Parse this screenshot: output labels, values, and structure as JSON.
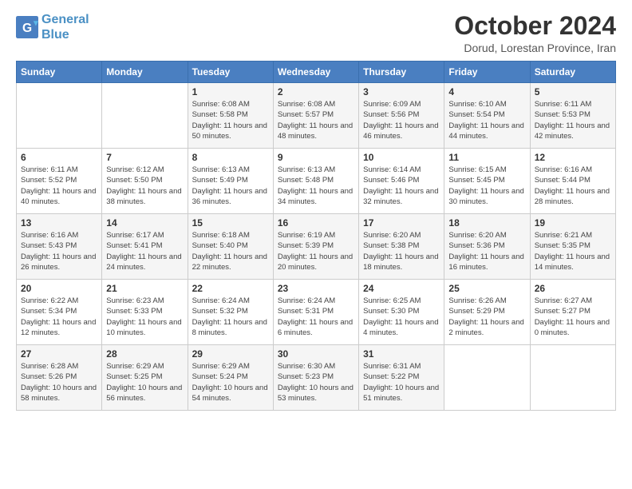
{
  "logo": {
    "line1": "General",
    "line2": "Blue"
  },
  "title": "October 2024",
  "subtitle": "Dorud, Lorestan Province, Iran",
  "days_of_week": [
    "Sunday",
    "Monday",
    "Tuesday",
    "Wednesday",
    "Thursday",
    "Friday",
    "Saturday"
  ],
  "weeks": [
    [
      {
        "day": "",
        "info": ""
      },
      {
        "day": "",
        "info": ""
      },
      {
        "day": "1",
        "info": "Sunrise: 6:08 AM\nSunset: 5:58 PM\nDaylight: 11 hours and 50 minutes."
      },
      {
        "day": "2",
        "info": "Sunrise: 6:08 AM\nSunset: 5:57 PM\nDaylight: 11 hours and 48 minutes."
      },
      {
        "day": "3",
        "info": "Sunrise: 6:09 AM\nSunset: 5:56 PM\nDaylight: 11 hours and 46 minutes."
      },
      {
        "day": "4",
        "info": "Sunrise: 6:10 AM\nSunset: 5:54 PM\nDaylight: 11 hours and 44 minutes."
      },
      {
        "day": "5",
        "info": "Sunrise: 6:11 AM\nSunset: 5:53 PM\nDaylight: 11 hours and 42 minutes."
      }
    ],
    [
      {
        "day": "6",
        "info": "Sunrise: 6:11 AM\nSunset: 5:52 PM\nDaylight: 11 hours and 40 minutes."
      },
      {
        "day": "7",
        "info": "Sunrise: 6:12 AM\nSunset: 5:50 PM\nDaylight: 11 hours and 38 minutes."
      },
      {
        "day": "8",
        "info": "Sunrise: 6:13 AM\nSunset: 5:49 PM\nDaylight: 11 hours and 36 minutes."
      },
      {
        "day": "9",
        "info": "Sunrise: 6:13 AM\nSunset: 5:48 PM\nDaylight: 11 hours and 34 minutes."
      },
      {
        "day": "10",
        "info": "Sunrise: 6:14 AM\nSunset: 5:46 PM\nDaylight: 11 hours and 32 minutes."
      },
      {
        "day": "11",
        "info": "Sunrise: 6:15 AM\nSunset: 5:45 PM\nDaylight: 11 hours and 30 minutes."
      },
      {
        "day": "12",
        "info": "Sunrise: 6:16 AM\nSunset: 5:44 PM\nDaylight: 11 hours and 28 minutes."
      }
    ],
    [
      {
        "day": "13",
        "info": "Sunrise: 6:16 AM\nSunset: 5:43 PM\nDaylight: 11 hours and 26 minutes."
      },
      {
        "day": "14",
        "info": "Sunrise: 6:17 AM\nSunset: 5:41 PM\nDaylight: 11 hours and 24 minutes."
      },
      {
        "day": "15",
        "info": "Sunrise: 6:18 AM\nSunset: 5:40 PM\nDaylight: 11 hours and 22 minutes."
      },
      {
        "day": "16",
        "info": "Sunrise: 6:19 AM\nSunset: 5:39 PM\nDaylight: 11 hours and 20 minutes."
      },
      {
        "day": "17",
        "info": "Sunrise: 6:20 AM\nSunset: 5:38 PM\nDaylight: 11 hours and 18 minutes."
      },
      {
        "day": "18",
        "info": "Sunrise: 6:20 AM\nSunset: 5:36 PM\nDaylight: 11 hours and 16 minutes."
      },
      {
        "day": "19",
        "info": "Sunrise: 6:21 AM\nSunset: 5:35 PM\nDaylight: 11 hours and 14 minutes."
      }
    ],
    [
      {
        "day": "20",
        "info": "Sunrise: 6:22 AM\nSunset: 5:34 PM\nDaylight: 11 hours and 12 minutes."
      },
      {
        "day": "21",
        "info": "Sunrise: 6:23 AM\nSunset: 5:33 PM\nDaylight: 11 hours and 10 minutes."
      },
      {
        "day": "22",
        "info": "Sunrise: 6:24 AM\nSunset: 5:32 PM\nDaylight: 11 hours and 8 minutes."
      },
      {
        "day": "23",
        "info": "Sunrise: 6:24 AM\nSunset: 5:31 PM\nDaylight: 11 hours and 6 minutes."
      },
      {
        "day": "24",
        "info": "Sunrise: 6:25 AM\nSunset: 5:30 PM\nDaylight: 11 hours and 4 minutes."
      },
      {
        "day": "25",
        "info": "Sunrise: 6:26 AM\nSunset: 5:29 PM\nDaylight: 11 hours and 2 minutes."
      },
      {
        "day": "26",
        "info": "Sunrise: 6:27 AM\nSunset: 5:27 PM\nDaylight: 11 hours and 0 minutes."
      }
    ],
    [
      {
        "day": "27",
        "info": "Sunrise: 6:28 AM\nSunset: 5:26 PM\nDaylight: 10 hours and 58 minutes."
      },
      {
        "day": "28",
        "info": "Sunrise: 6:29 AM\nSunset: 5:25 PM\nDaylight: 10 hours and 56 minutes."
      },
      {
        "day": "29",
        "info": "Sunrise: 6:29 AM\nSunset: 5:24 PM\nDaylight: 10 hours and 54 minutes."
      },
      {
        "day": "30",
        "info": "Sunrise: 6:30 AM\nSunset: 5:23 PM\nDaylight: 10 hours and 53 minutes."
      },
      {
        "day": "31",
        "info": "Sunrise: 6:31 AM\nSunset: 5:22 PM\nDaylight: 10 hours and 51 minutes."
      },
      {
        "day": "",
        "info": ""
      },
      {
        "day": "",
        "info": ""
      }
    ]
  ]
}
